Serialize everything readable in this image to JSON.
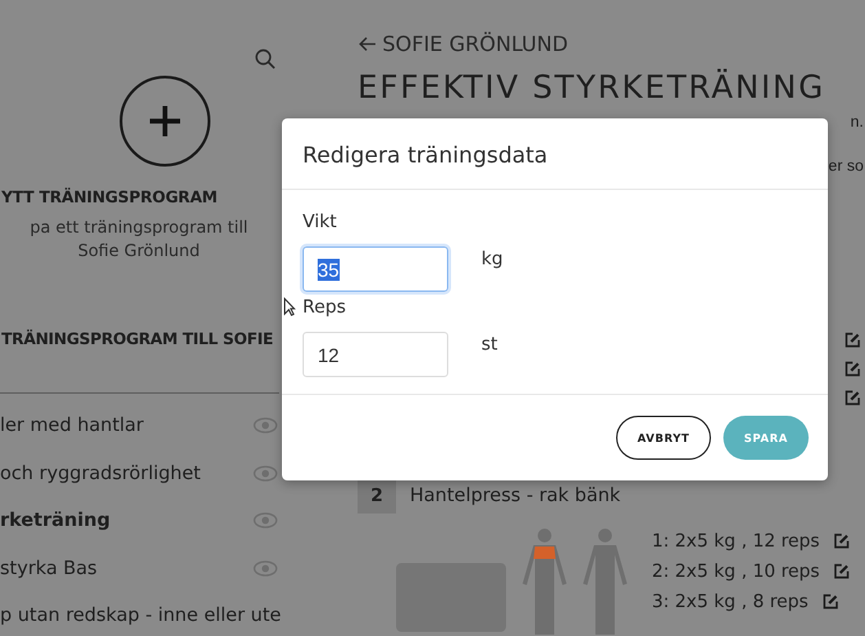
{
  "sidebar": {
    "new_program": {
      "title": "YTT TRÄNINGSPROGRAM",
      "description": "pa ett träningsprogram till Sofie Grönlund"
    },
    "section_title": "TRÄNINGSPROGRAM TILL SOFIE",
    "programs": [
      {
        "name": "ler med hantlar",
        "selected": false
      },
      {
        "name": "och ryggradsrörlighet",
        "selected": false
      },
      {
        "name": "rketräning",
        "selected": true
      },
      {
        "name": "styrka Bas",
        "selected": false
      },
      {
        "name": "p utan redskap - inne eller ute",
        "selected": false
      }
    ]
  },
  "main": {
    "back_link": "SOFIE GRÖNLUND",
    "title": "EFFEKTIV STYRKETRÄNING",
    "text_fragments": [
      "n.",
      "er so"
    ],
    "exercises": [
      {
        "number": "2",
        "name": "Hantelpress - rak bänk",
        "sets": [
          "1: 2x5 kg , 12 reps",
          "2: 2x5 kg , 10 reps",
          "3: 2x5 kg , 8 reps"
        ]
      }
    ]
  },
  "dialog": {
    "title": "Redigera träningsdata",
    "fields": [
      {
        "label": "Vikt",
        "value": "35",
        "unit": "kg",
        "focused": true,
        "text_selected": true
      },
      {
        "label": "Reps",
        "value": "12",
        "unit": "st",
        "focused": false,
        "text_selected": false
      }
    ],
    "buttons": [
      {
        "label": "AVBRYT",
        "kind": "secondary"
      },
      {
        "label": "SPARA",
        "kind": "primary"
      }
    ]
  }
}
